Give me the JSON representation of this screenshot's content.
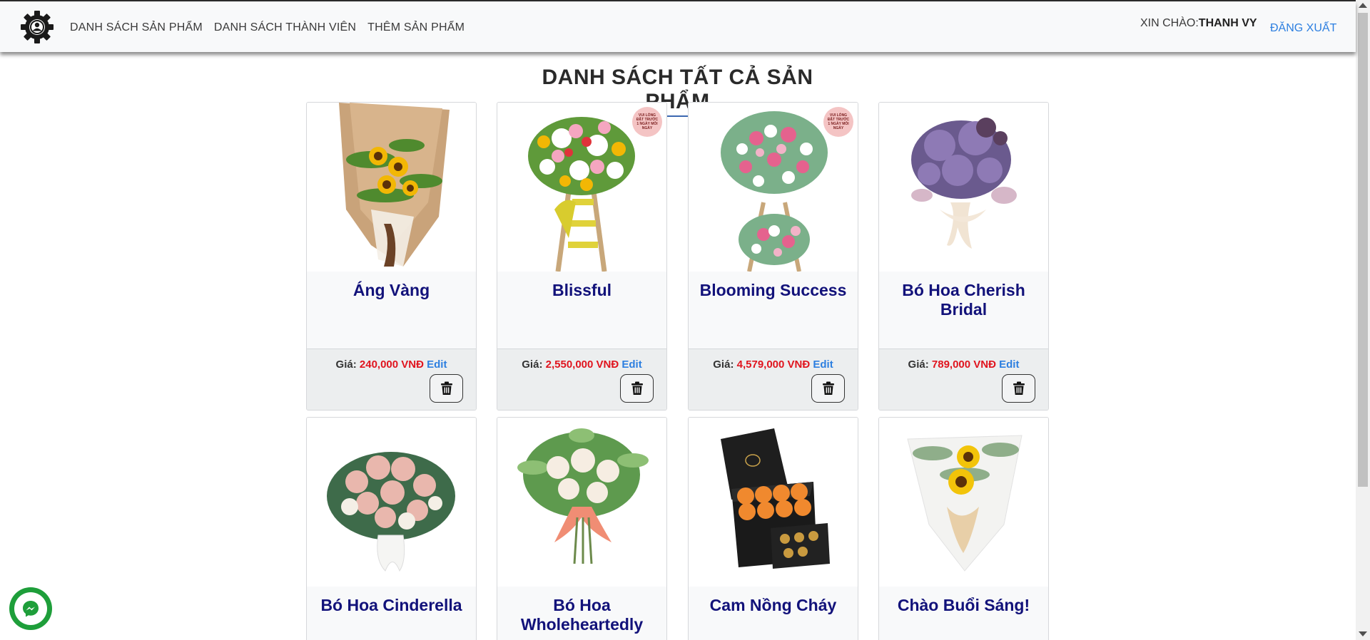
{
  "navbar": {
    "links": [
      "DANH SÁCH SẢN PHẨM",
      "DANH SÁCH THÀNH VIÊN",
      "THÊM SẢN PHẨM"
    ],
    "greeting_prefix": "XIN CHÀO:",
    "username": "THANH VY",
    "logout": "ĐĂNG XUẤT"
  },
  "page": {
    "title": "DANH SÁCH TẤT CẢ SẢN PHẨM"
  },
  "labels": {
    "price_prefix": "Giá:",
    "edit": "Edit"
  },
  "products": [
    {
      "name": "Áng Vàng",
      "price": "240,000 VNĐ",
      "image": "sunflower-bouquet"
    },
    {
      "name": "Blissful",
      "price": "2,550,000 VNĐ",
      "image": "flower-stand-yellow",
      "badge": "VUI LÒNG ĐẶT TRƯỚC 1 NGÀY MỖI NGÀY"
    },
    {
      "name": "Blooming Success",
      "price": "4,579,000 VNĐ",
      "image": "flower-stand-pink",
      "badge": "VUI LÒNG ĐẶT TRƯỚC 1 NGÀY MỖI NGÀY"
    },
    {
      "name": "Bó Hoa Cherish Bridal",
      "price": "789,000 VNĐ",
      "image": "purple-bridal-bouquet"
    },
    {
      "name": "Bó Hoa Cinderella",
      "price": "",
      "image": "pink-rose-bouquet"
    },
    {
      "name": "Bó Hoa Wholeheartedly",
      "price": "",
      "image": "white-rose-bouquet"
    },
    {
      "name": "Cam Nồng Cháy",
      "price": "",
      "image": "orange-rose-box"
    },
    {
      "name": "Chào Buổi Sáng!",
      "price": "",
      "image": "sunflower-white-wrap"
    }
  ],
  "colors": {
    "title_blue": "#12127a",
    "price_red": "#e0141e",
    "link_blue": "#2d7fe0",
    "messenger_green": "#1e9e3a"
  },
  "icons": {
    "logo": "gear-user-icon",
    "delete": "trash-icon",
    "chat": "messenger-icon"
  }
}
